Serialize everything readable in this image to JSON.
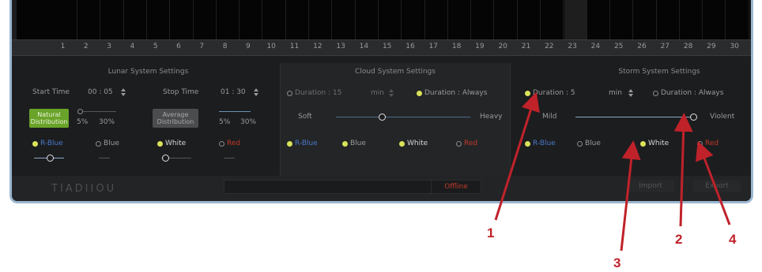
{
  "timeline": {
    "numbers": [
      "1",
      "2",
      "3",
      "4",
      "5",
      "6",
      "7",
      "8",
      "9",
      "10",
      "11",
      "12",
      "13",
      "14",
      "15",
      "16",
      "17",
      "18",
      "19",
      "20",
      "21",
      "22",
      "23",
      "24",
      "25",
      "26",
      "27",
      "28",
      "29",
      "30"
    ]
  },
  "lunar": {
    "title": "Lunar System Settings",
    "start_label": "Start Time",
    "start_value": "00 : 05",
    "stop_label": "Stop Time",
    "stop_value": "01 : 30",
    "natural_button": "Natural Distribution",
    "average_button": "Average Distribution",
    "pct_low_1": "5%",
    "pct_high_1": "30%",
    "pct_low_2": "5%",
    "pct_high_2": "30%",
    "channels": [
      "R-Blue",
      "Blue",
      "White",
      "Red"
    ]
  },
  "cloud": {
    "title": "Cloud System Settings",
    "duration_label": "Duration : 15",
    "min_label": "min",
    "always_label": "Duration : Always",
    "soft_label": "Soft",
    "heavy_label": "Heavy",
    "channels": [
      "R-Blue",
      "Blue",
      "White",
      "Red"
    ]
  },
  "storm": {
    "title": "Storm System Settings",
    "duration_label": "Duration : 5",
    "min_label": "min",
    "always_label": "Duration : Always",
    "mild_label": "Mild",
    "violent_label": "Violent",
    "channels": [
      "R-Blue",
      "Blue",
      "White",
      "Red"
    ]
  },
  "footer": {
    "logo": "TIADIIOU",
    "status": "Offline",
    "import_label": "Import",
    "export_label": "Export"
  },
  "callouts": [
    "1",
    "2",
    "3",
    "4"
  ],
  "colors": {
    "rblue": "#4a78c8",
    "white": "#d8d8d8",
    "red": "#c0392b",
    "accent": "#d9e35a",
    "callout": "#c0222a"
  }
}
